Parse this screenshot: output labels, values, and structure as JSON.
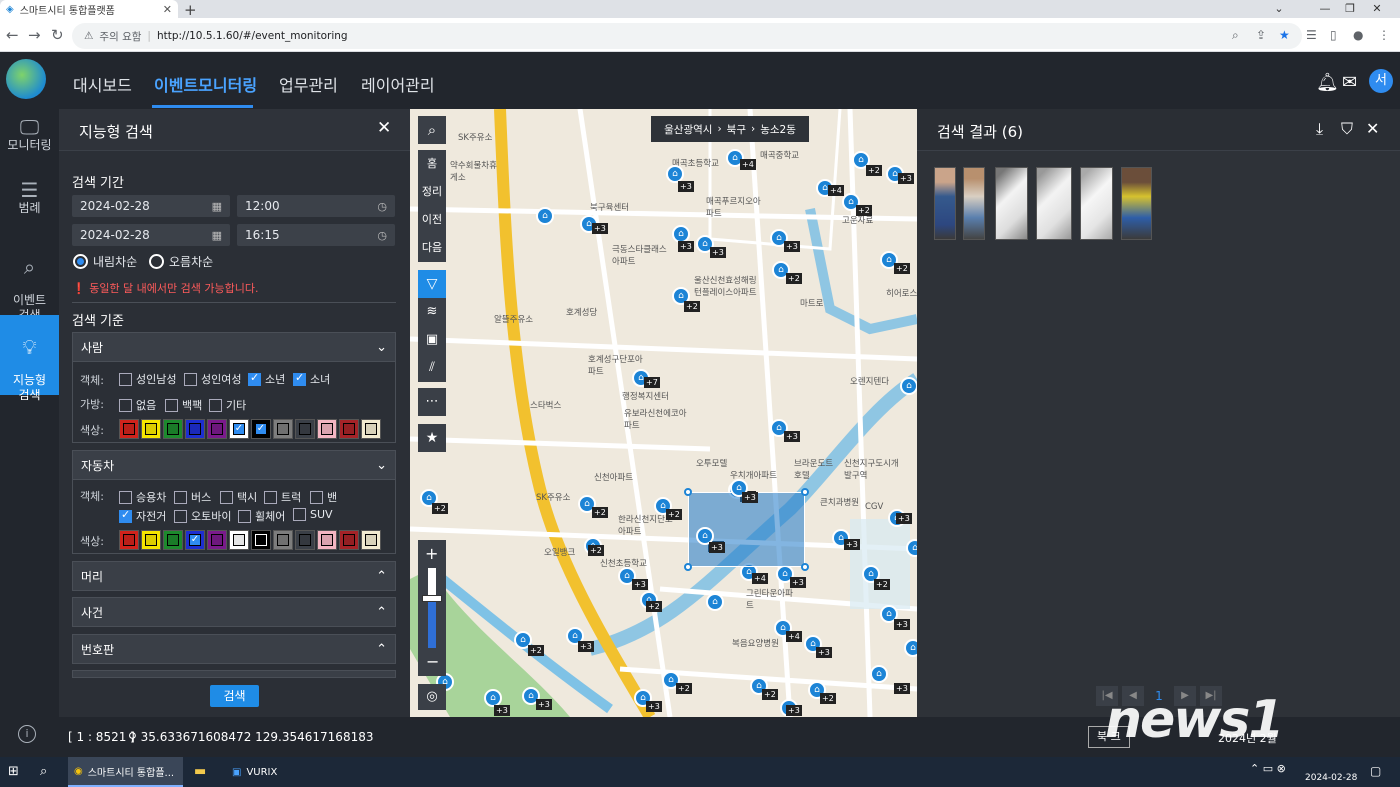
{
  "browser": {
    "tab_title": "스마트시티 통합플랫폼",
    "security": "주의 요함",
    "url": "http://10.5.1.60/#/event_monitoring"
  },
  "header": {
    "nav": [
      "대시보드",
      "이벤트모니터링",
      "업무관리",
      "레이어관리"
    ],
    "active_nav": "이벤트모니터링",
    "avatar_letter": "서",
    "accent": "#2f8cf0"
  },
  "rail": {
    "items": [
      {
        "label": "모니터링",
        "icon": "monitor-icon"
      },
      {
        "label": "범례",
        "icon": "list-icon"
      },
      {
        "label": "이벤트\n검색",
        "icon": "search-icon"
      },
      {
        "label": "지능형\n검색",
        "icon": "lightbulb-icon"
      }
    ]
  },
  "panel": {
    "title": "지능형 검색",
    "period_label": "검색 기간",
    "start_date": "2024-02-28",
    "start_time": "12:00",
    "end_date": "2024-02-28",
    "end_time": "16:15",
    "sort_desc": "내림차순",
    "sort_asc": "오름차순",
    "warning": "동일한 달 내에서만 검색 가능합니다.",
    "criteria_label": "검색 기준",
    "person": {
      "title": "사람",
      "object_label": "객체:",
      "objects": [
        {
          "label": "성인남성",
          "checked": false
        },
        {
          "label": "성인여성",
          "checked": false
        },
        {
          "label": "소년",
          "checked": true
        },
        {
          "label": "소녀",
          "checked": true
        }
      ],
      "bag_label": "가방:",
      "bags": [
        {
          "label": "없음",
          "checked": false
        },
        {
          "label": "백팩",
          "checked": false
        },
        {
          "label": "기타",
          "checked": false
        }
      ],
      "color_label": "색상:"
    },
    "vehicle": {
      "title": "자동차",
      "object_label": "객체:",
      "objects_row1": [
        {
          "label": "승용차",
          "checked": false
        },
        {
          "label": "버스",
          "checked": false
        },
        {
          "label": "택시",
          "checked": false
        },
        {
          "label": "트럭",
          "checked": false
        },
        {
          "label": "밴",
          "checked": false
        }
      ],
      "objects_row2": [
        {
          "label": "자전거",
          "checked": true
        },
        {
          "label": "오토바이",
          "checked": false
        },
        {
          "label": "휠체어",
          "checked": false
        },
        {
          "label": "SUV",
          "checked": false
        }
      ],
      "color_label": "색상:"
    },
    "sections": [
      "머리",
      "사건",
      "번호판"
    ],
    "search_button": "검색"
  },
  "map": {
    "breadcrumb": [
      "울산광역시",
      "북구",
      "농소2동"
    ],
    "tools": [
      "홈",
      "정리",
      "이전",
      "다음"
    ],
    "labels": [
      "SK주유소",
      "약수회물차휴게소",
      "북구육센터",
      "매곡초등학교",
      "매곡중학교",
      "매곡푸르지오아파트",
      "극동스타클래스아파트",
      "울산신천효성해링턴플레이스아파트",
      "알뜰주유소",
      "호계성당",
      "호계성구단포아파트",
      "행정복지센터",
      "유보라신천에코아파트",
      "스타벅스",
      "오투모텔",
      "신천아파트",
      "SK주유소",
      "오일뱅크",
      "한라신천지단포아파트",
      "신천초등학교",
      "그린타운아파트",
      "복음요양병원",
      "큰치과병원",
      "CGV",
      "브라운도트호텔",
      "신천지구도시개발구역",
      "오렌지텐다",
      "히어로스",
      "마트로",
      "고운자료",
      "우치개아파트"
    ]
  },
  "results": {
    "title": "검색 결과 (6)",
    "thumbnails": 6,
    "current_page": "1"
  },
  "status": {
    "scale": "[ 1 : 8521 ]",
    "coords": "35.633671608472 129.354617168183",
    "right_button": "북 크",
    "date_fragment": "2024년 2월",
    "watermark": "news1"
  },
  "taskbar": {
    "chrome_label": "스마트시티 통합플...",
    "vurix_label": "VURIX",
    "clock_date": "2024-02-28"
  }
}
